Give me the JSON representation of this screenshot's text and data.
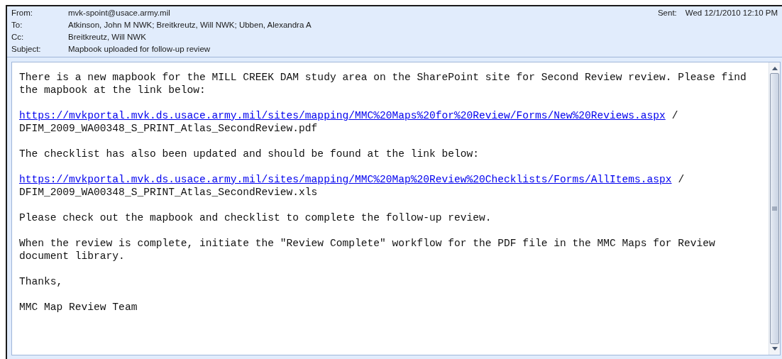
{
  "header": {
    "fields": [
      {
        "label": "From:",
        "value": "mvk-spoint@usace.army.mil"
      },
      {
        "label": "To:",
        "value": "Atkinson, John M NWK; Breitkreutz, Will NWK; Ubben, Alexandra A"
      },
      {
        "label": "Cc:",
        "value": "Breitkreutz, Will NWK"
      },
      {
        "label": "Subject:",
        "value": "Mapbook uploaded for follow-up review"
      }
    ],
    "sent": {
      "label": "Sent:",
      "value": "Wed 12/1/2010 12:10 PM"
    }
  },
  "body": [
    {
      "kind": "text",
      "text": "There is a new mapbook for the MILL CREEK DAM study area on the SharePoint site for Second Review review. Please find the mapbook at the link below:"
    },
    {
      "kind": "link",
      "url": "https://mvkportal.mvk.ds.usace.army.mil/sites/mapping/MMC%20Maps%20for%20Review/Forms/New%20Reviews.aspx",
      "separator": "/",
      "file": "DFIM_2009_WA00348_S_PRINT_Atlas_SecondReview.pdf"
    },
    {
      "kind": "text",
      "text": "The checklist has also been updated and should be found at the link below:"
    },
    {
      "kind": "link",
      "url": "https://mvkportal.mvk.ds.usace.army.mil/sites/mapping/MMC%20Map%20Review%20Checklists/Forms/AllItems.aspx",
      "separator": "/",
      "file": "DFIM_2009_WA00348_S_PRINT_Atlas_SecondReview.xls"
    },
    {
      "kind": "text",
      "text": "Please check out the mapbook and checklist to complete the follow-up review."
    },
    {
      "kind": "text",
      "text": "When the review is complete, initiate the \"Review Complete\" workflow for the PDF file in the MMC Maps for Review document library."
    },
    {
      "kind": "text",
      "text": "Thanks,"
    },
    {
      "kind": "text",
      "text": "MMC Map Review Team"
    }
  ]
}
